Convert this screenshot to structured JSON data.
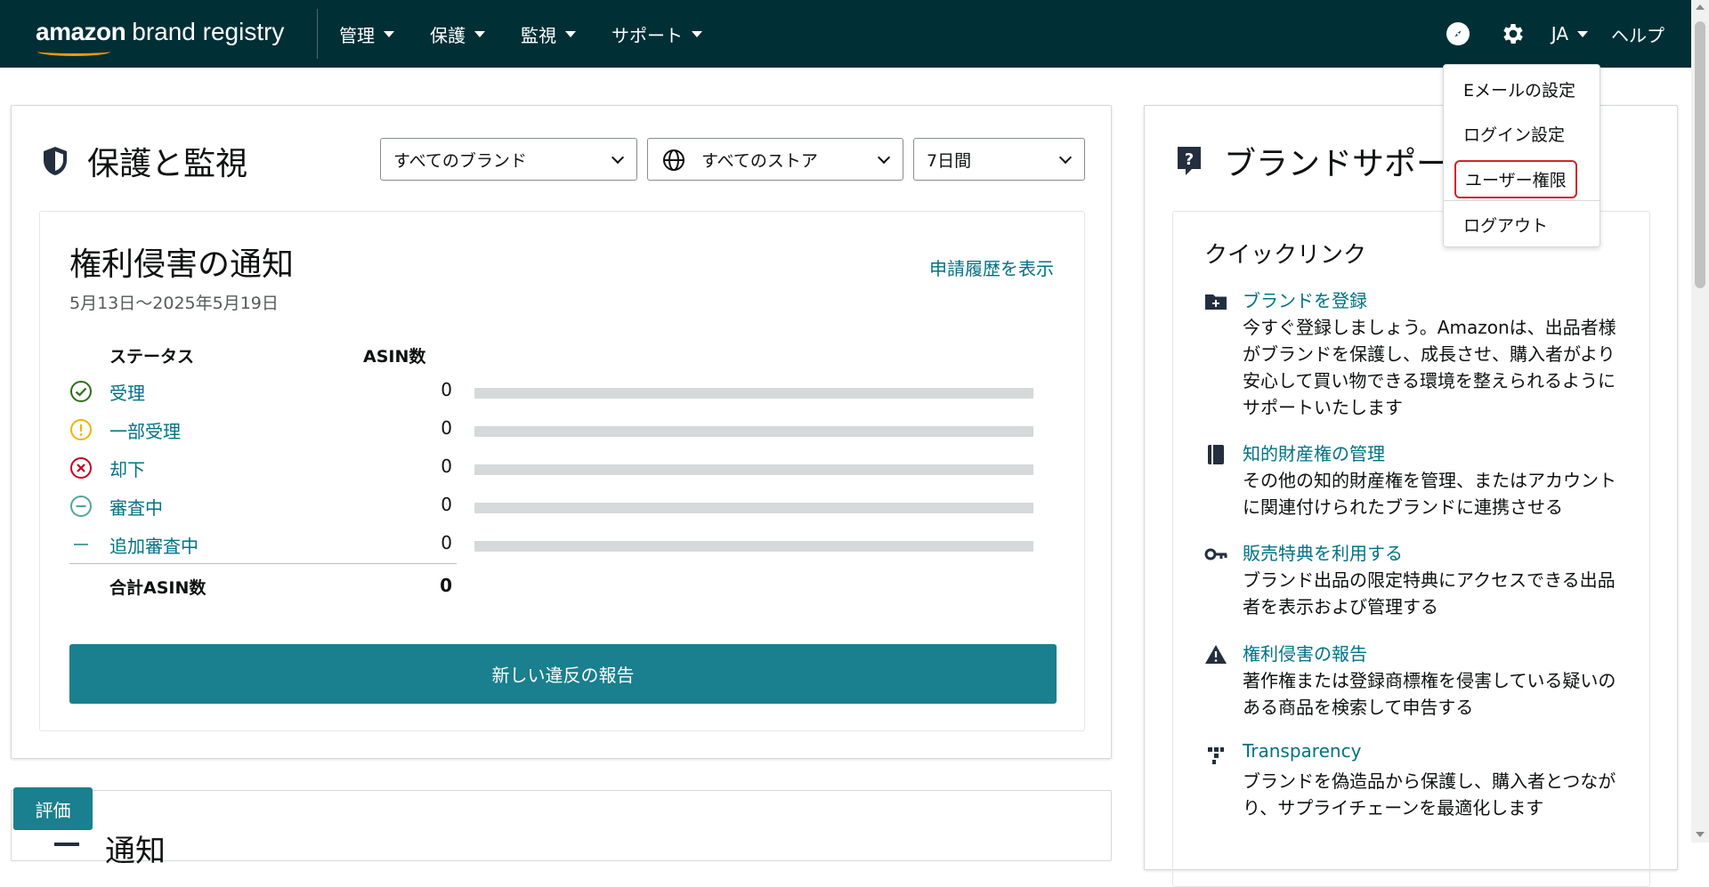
{
  "nav": {
    "logo_bold": "amazon",
    "logo_rest": "brand registry",
    "menu": [
      {
        "label": "管理"
      },
      {
        "label": "保護"
      },
      {
        "label": "監視"
      },
      {
        "label": "サポート"
      }
    ],
    "lang": "JA",
    "help": "ヘルプ"
  },
  "account_menu": {
    "items": [
      "Eメールの設定",
      "ログイン設定",
      "ユーザー権限",
      "ログアウト"
    ]
  },
  "protect": {
    "title": "保護と監視",
    "brand_select": "すべてのブランド",
    "store_select": "すべてのストア",
    "period_select": "7日間"
  },
  "notices": {
    "title": "権利侵害の通知",
    "history_link": "申請履歴を表示",
    "date_range": "5月13日〜2025年5月19日",
    "header_status": "ステータス",
    "header_count": "ASIN数",
    "rows": [
      {
        "label": "受理",
        "count": "0",
        "value": 0
      },
      {
        "label": "一部受理",
        "count": "0",
        "value": 0
      },
      {
        "label": "却下",
        "count": "0",
        "value": 0
      },
      {
        "label": "審査中",
        "count": "0",
        "value": 0
      },
      {
        "label": "追加審査中",
        "count": "0",
        "value": 0
      }
    ],
    "total_label": "合計ASIN数",
    "total_value": "0",
    "report_button": "新しい違反の報告"
  },
  "notify": {
    "title": "通知"
  },
  "feedback": "評価",
  "support": {
    "title": "ブランドサポート",
    "quick_title": "クイックリンク",
    "links": [
      {
        "label": "ブランドを登録",
        "desc": "今すぐ登録しましょう。Amazonは、出品者様がブランドを保護し、成長させ、購入者がより安心して買い物できる環境を整えられるようにサポートいたします",
        "icon": "folder-plus-icon"
      },
      {
        "label": "知的財産権の管理",
        "desc": "その他の知的財産権を管理、またはアカウントに関連付けられたブランドに連携させる",
        "icon": "book-icon"
      },
      {
        "label": "販売特典を利用する",
        "desc": "ブランド出品の限定特典にアクセスできる出品者を表示および管理する",
        "icon": "key-icon"
      },
      {
        "label": "権利侵害の報告",
        "desc": "著作権または登録商標権を侵害している疑いのある商品を検索して申告する",
        "icon": "warning-icon"
      },
      {
        "label": "Transparency",
        "desc": "ブランドを偽造品から保護し、購入者とつながり、サプライチェーンを最適化します",
        "icon": "transparency-icon"
      }
    ]
  },
  "colors": {
    "nav_bg": "#002f36",
    "link": "#007185",
    "primary_button": "#1a7f8e",
    "accepted": "#067d62",
    "partial": "#f0b400",
    "rejected": "#c40022",
    "reviewing": "#4fa79a",
    "highlight_border": "#d0232c"
  }
}
